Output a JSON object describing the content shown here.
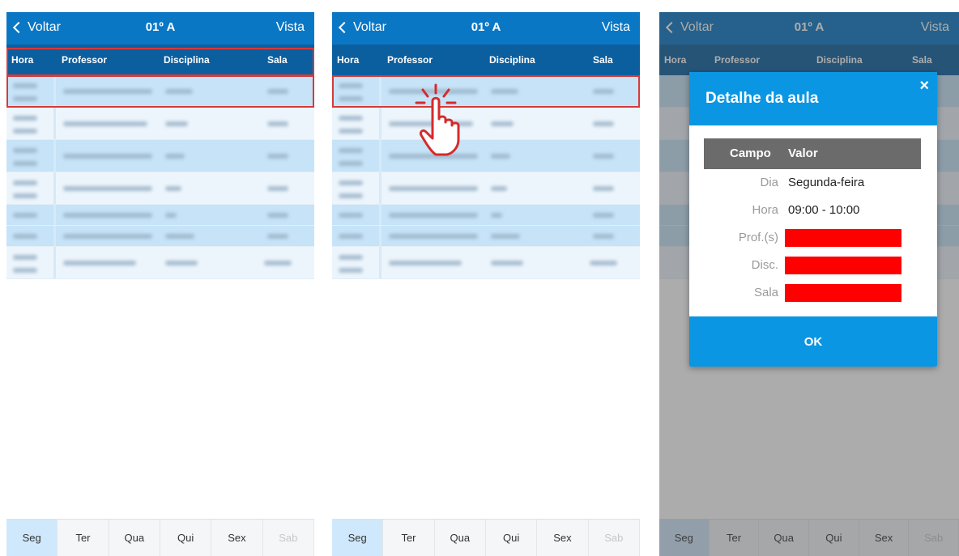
{
  "panels": [
    {
      "back_label": "Voltar",
      "title": "01º A",
      "view_label": "Vista",
      "columns": [
        "Hora",
        "Professor",
        "Disciplina",
        "Sala"
      ],
      "days": [
        "Seg",
        "Ter",
        "Qua",
        "Qui",
        "Sex",
        "Sab"
      ]
    },
    {
      "back_label": "Voltar",
      "title": "01º A",
      "view_label": "Vista",
      "columns": [
        "Hora",
        "Professor",
        "Disciplina",
        "Sala"
      ],
      "days": [
        "Seg",
        "Ter",
        "Qua",
        "Qui",
        "Sex",
        "Sab"
      ]
    },
    {
      "back_label": "Voltar",
      "title": "01º A",
      "view_label": "Vista",
      "columns": [
        "Hora",
        "Professor",
        "Disciplina",
        "Sala"
      ],
      "days": [
        "Seg",
        "Ter",
        "Qua",
        "Qui",
        "Sex",
        "Sab"
      ]
    }
  ],
  "dialog": {
    "title": "Detalhe da aula",
    "close_label": "×",
    "col_field": "Campo",
    "col_value": "Valor",
    "rows": [
      {
        "key": "Dia",
        "value": "Segunda-feira"
      },
      {
        "key": "Hora",
        "value": "09:00 - 10:00"
      },
      {
        "key": "Prof.(s)",
        "value": ""
      },
      {
        "key": "Disc.",
        "value": ""
      },
      {
        "key": "Sala",
        "value": ""
      }
    ],
    "ok_label": "OK"
  },
  "colors": {
    "topbar": "#0a77c5",
    "header_row": "#0c5f9f",
    "dialog_accent": "#0b96e3",
    "highlight": "#d63a3a",
    "redacted": "#ff0000"
  }
}
